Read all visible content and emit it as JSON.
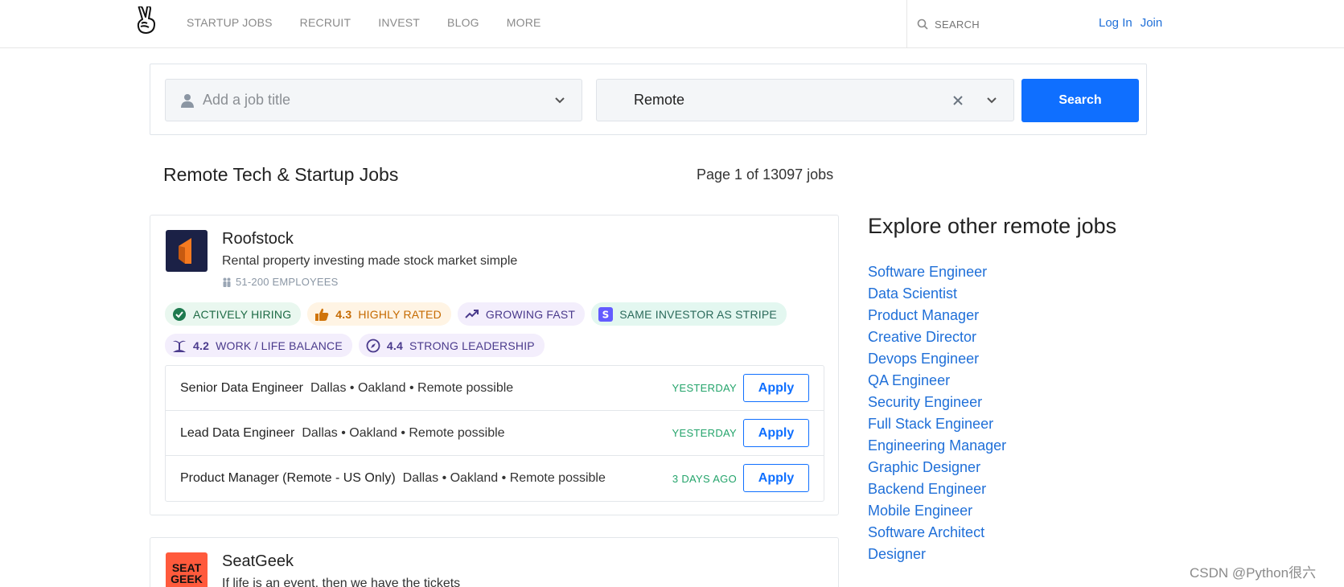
{
  "nav": {
    "items": [
      "STARTUP JOBS",
      "RECRUIT",
      "INVEST",
      "BLOG",
      "MORE"
    ],
    "search_placeholder": "SEARCH",
    "login": "Log In",
    "join": "Join"
  },
  "search": {
    "job_placeholder": "Add a job title",
    "location_value": "Remote",
    "button": "Search"
  },
  "heading": "Remote Tech & Startup Jobs",
  "page_count": "Page 1 of 13097 jobs",
  "company": {
    "name": "Roofstock",
    "tagline": "Rental property investing made stock market simple",
    "size": "51-200 EMPLOYEES",
    "badges": {
      "hiring": "ACTIVELY HIRING",
      "rated_num": "4.3",
      "rated": "HIGHLY RATED",
      "growing": "GROWING FAST",
      "investor": "SAME INVESTOR AS STRIPE",
      "wlb_num": "4.2",
      "wlb": "WORK / LIFE BALANCE",
      "lead_num": "4.4",
      "lead": "STRONG LEADERSHIP"
    },
    "jobs": [
      {
        "title": "Senior Data Engineer",
        "location": "Dallas • Oakland • Remote possible",
        "date": "YESTERDAY",
        "apply": "Apply"
      },
      {
        "title": "Lead Data Engineer",
        "location": "Dallas • Oakland • Remote possible",
        "date": "YESTERDAY",
        "apply": "Apply"
      },
      {
        "title": "Product Manager (Remote - US Only)",
        "location": "Dallas • Oakland • Remote possible",
        "date": "3 DAYS AGO",
        "apply": "Apply"
      }
    ]
  },
  "company2": {
    "name": "SeatGeek",
    "tagline": "If life is an event, then we have the tickets",
    "logo_line1": "SEAT",
    "logo_line2": "GEEK"
  },
  "sidebar": {
    "title": "Explore other remote jobs",
    "links": [
      "Software Engineer",
      "Data Scientist",
      "Product Manager",
      "Creative Director",
      "Devops Engineer",
      "QA Engineer",
      "Security Engineer",
      "Full Stack Engineer",
      "Engineering Manager",
      "Graphic Designer",
      "Backend Engineer",
      "Mobile Engineer",
      "Software Architect",
      "Designer"
    ]
  },
  "watermark": "CSDN @Python很六",
  "colors": {
    "accent": "#0f6fff",
    "link": "#1f6fd8",
    "success": "#24a46b"
  }
}
